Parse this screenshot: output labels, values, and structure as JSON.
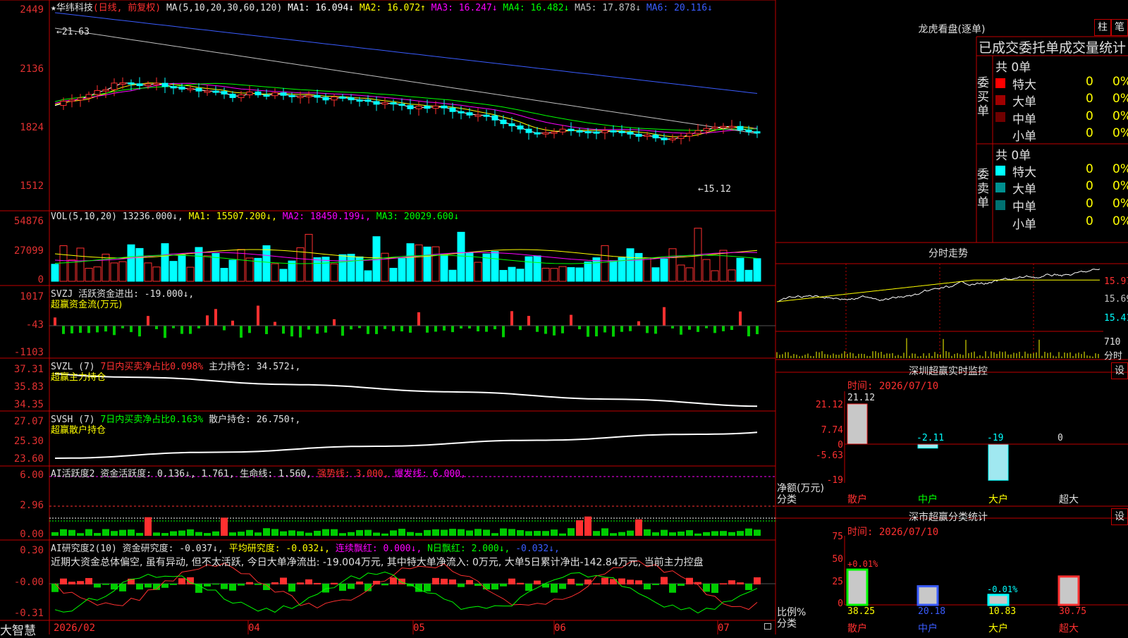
{
  "app": {
    "logo": "大智慧"
  },
  "stock_header": {
    "name": "★华纬科技",
    "mode": "(日线, 前复权)",
    "ma_params": "MA(5,10,20,30,60,120)",
    "ma": [
      {
        "label": "MA1: 16.094↓",
        "color": "#ffffff"
      },
      {
        "label": "MA2: 16.072↑",
        "color": "#ffff00"
      },
      {
        "label": "MA3: 16.247↓",
        "color": "#ff00ff"
      },
      {
        "label": "MA4: 16.482↓",
        "color": "#00ff00"
      },
      {
        "label": "MA5: 17.878↓",
        "color": "#c0c0c0"
      },
      {
        "label": "MA6: 20.116↓",
        "color": "#3a5cff"
      }
    ]
  },
  "price_axis": [
    "2449",
    "2136",
    "1824",
    "1512"
  ],
  "price_annotations": {
    "high": "←21.63",
    "low": "←15.12"
  },
  "vol_panel": {
    "axis": [
      "54876",
      "27099",
      "0"
    ],
    "header": [
      {
        "text": "VOL(5,10,20) 13236.000↓,",
        "color": "#c0c0c0"
      },
      {
        "text": "MA1: 15507.200↓,",
        "color": "#ffff00"
      },
      {
        "text": "MA2: 18450.199↓,",
        "color": "#ff00ff"
      },
      {
        "text": "MA3: 20029.600↓",
        "color": "#00ff00"
      }
    ]
  },
  "svzj_panel": {
    "axis": [
      "1017",
      "-43",
      "-1103"
    ],
    "header1": "SVZJ  活跃资金进出: -19.000↓,",
    "header2": "超赢资金流(万元)"
  },
  "svzl_panel": {
    "axis": [
      "37.31",
      "35.83",
      "34.35"
    ],
    "header_prefix": "SVZL (7)",
    "header_red": "7日内买卖净占比0.098%",
    "header_white": "主力持仓: 34.572↓,",
    "header2": "超赢主力持仓"
  },
  "svsh_panel": {
    "axis": [
      "27.07",
      "25.30",
      "23.60"
    ],
    "header_prefix": "SVSH (7)",
    "header_green": "7日内买卖净占比0.163%",
    "header_white": "散户持仓: 26.750↑,",
    "header2": "超赢散户持仓"
  },
  "ai_activity_panel": {
    "axis": [
      "6.00",
      "2.96",
      "0.00"
    ],
    "header": [
      {
        "text": "AI活跃度2 资金活跃度: 0.136↓, 1.761, 生命线: 1.560,",
        "color": "#e0e0e0"
      },
      {
        "text": "强势线: 3.000,",
        "color": "#ff3030"
      },
      {
        "text": "爆发线: 6.000,",
        "color": "#ff00ff"
      }
    ]
  },
  "ai_research_panel": {
    "axis": [
      "0.30",
      "-0.00",
      "-0.31"
    ],
    "header": [
      {
        "text": "AI研究度2(10) 资金研究度: -0.037↓,",
        "color": "#e0e0e0"
      },
      {
        "text": "平均研究度: -0.032↓,",
        "color": "#ffff00"
      },
      {
        "text": "连续飘红: 0.000↓,",
        "color": "#ff00ff"
      },
      {
        "text": "N日飘红: 2.000↓,",
        "color": "#00ff00"
      },
      {
        "text": "-0.032↓,",
        "color": "#3a5cff"
      }
    ],
    "summary": "近期大资金总体偏空, 虽有异动, 但不太活跃, 今日大单净流出: -19.004万元, 其中特大单净流入: 0万元, 大单5日累计净出-142.84万元, 当前主力控盘"
  },
  "date_axis": [
    "2026/02",
    "04",
    "05",
    "06",
    "07"
  ],
  "longhu": {
    "title": "龙虎看盘(逐单)",
    "btn_column": "柱",
    "btn_pen": "笔",
    "tabs": "已成交委托单成交量统计",
    "buy": {
      "side_label": "委买单",
      "total": "共 0单",
      "rows": [
        {
          "name": "特大",
          "count": "0",
          "pct": "0%",
          "color": "#ff0000"
        },
        {
          "name": "大单",
          "count": "0",
          "pct": "0%",
          "color": "#a00000"
        },
        {
          "name": "中单",
          "count": "0",
          "pct": "0%",
          "color": "#700000"
        },
        {
          "name": "小单",
          "count": "0",
          "pct": "0%",
          "color": ""
        }
      ]
    },
    "sell": {
      "side_label": "委卖单",
      "total": "共 0单",
      "rows": [
        {
          "name": "特大",
          "count": "0",
          "pct": "0%",
          "color": "#00ffff"
        },
        {
          "name": "大单",
          "count": "0",
          "pct": "0%",
          "color": "#009090"
        },
        {
          "name": "中单",
          "count": "0",
          "pct": "0%",
          "color": "#007070"
        },
        {
          "name": "小单",
          "count": "0",
          "pct": "0%",
          "color": ""
        }
      ]
    }
  },
  "intraday": {
    "title": "分时走势",
    "axis": [
      "15.97",
      "15.69",
      "15.41"
    ],
    "vol_axis": "710",
    "vol_label": "分时"
  },
  "sz_monitor": {
    "title": "深圳超赢实时监控",
    "settings": "设",
    "time": "时间: 2026/07/10",
    "axis": [
      "21.12",
      "7.74",
      "0",
      "-5.63",
      "-19"
    ],
    "ylabel1": "净额(万元)",
    "ylabel2": "分类",
    "categories": [
      "散户",
      "中户",
      "大户",
      "超大"
    ],
    "value_labels": [
      "21.12",
      "-2.11",
      "-19",
      "0"
    ],
    "values": [
      21.12,
      -2.11,
      -19,
      0
    ]
  },
  "sz_class": {
    "title": "深市超赢分类统计",
    "settings": "设",
    "time": "时间: 2026/07/10",
    "axis": [
      "75",
      "50",
      "25",
      "0"
    ],
    "ylabel1": "比例%",
    "ylabel2": "分类",
    "categories": [
      "散户",
      "中户",
      "大户",
      "超大"
    ],
    "bottom_values": [
      "38.25",
      "20.18",
      "10.83",
      "30.75"
    ],
    "change_labels": [
      "+0.01%",
      "",
      "-0.01%",
      ""
    ],
    "values": [
      38.25,
      20.18,
      10.83,
      30.75
    ]
  }
}
